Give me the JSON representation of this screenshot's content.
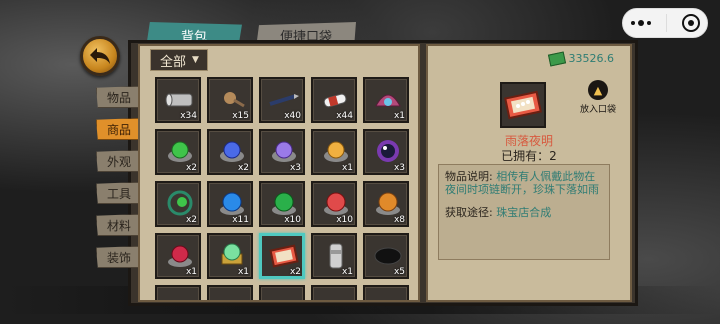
{
  "tabs": {
    "bag": "背包",
    "pocket": "便捷口袋"
  },
  "filter": {
    "label": "全部"
  },
  "side_tabs": [
    "物品",
    "商品",
    "外观",
    "工具",
    "材料",
    "装饰"
  ],
  "active_side_tab": "商品",
  "currency": {
    "amount": "33526.6",
    "icon": "money-icon"
  },
  "selected_item": {
    "name": "雨落夜明",
    "owned_label": "已拥有：2",
    "add_to_pocket": "放入口袋",
    "desc_label": "物品说明:",
    "desc_text": "相传有人佩戴此物在夜间时项链断开，珍珠下落如雨",
    "source_label": "获取途径:",
    "source_text": "珠宝店合成"
  },
  "items": [
    {
      "icon": "tin-can-icon",
      "qty": "x34"
    },
    {
      "icon": "trinket-icon",
      "qty": "x15"
    },
    {
      "icon": "dart-icon",
      "qty": "x40"
    },
    {
      "icon": "bottle-icon",
      "qty": "x44"
    },
    {
      "icon": "shell-icon",
      "qty": "x1"
    },
    {
      "icon": "green-pearl-icon",
      "qty": "x2"
    },
    {
      "icon": "blue-pearl-icon",
      "qty": "x2"
    },
    {
      "icon": "purple-pearl-icon",
      "qty": "x3"
    },
    {
      "icon": "gold-pearl-icon",
      "qty": "x1"
    },
    {
      "icon": "dark-pearl-icon",
      "qty": "x3"
    },
    {
      "icon": "green-necklace-icon",
      "qty": "x2"
    },
    {
      "icon": "blue-gem-icon",
      "qty": "x11"
    },
    {
      "icon": "emerald-gem-icon",
      "qty": "x10"
    },
    {
      "icon": "red-gem-icon",
      "qty": "x10"
    },
    {
      "icon": "amber-gem-icon",
      "qty": "x8"
    },
    {
      "icon": "ruby-pearl-icon",
      "qty": "x1"
    },
    {
      "icon": "jade-pendant-icon",
      "qty": "x1"
    },
    {
      "icon": "pearl-box-icon",
      "qty": "x2"
    },
    {
      "icon": "grinder-icon",
      "qty": "x1"
    },
    {
      "icon": "black-stone-icon",
      "qty": "x5"
    },
    {
      "icon": "coin-icon",
      "qty": ""
    },
    {
      "icon": "unknown-icon",
      "qty": ""
    },
    {
      "icon": "unknown-icon",
      "qty": ""
    },
    {
      "icon": "unknown-icon",
      "qty": ""
    },
    {
      "icon": "unknown-icon",
      "qty": ""
    }
  ],
  "colors": {
    "accent": "#3d8b86",
    "active_tab": "#e0902a",
    "highlight": "#4fc9c0"
  }
}
